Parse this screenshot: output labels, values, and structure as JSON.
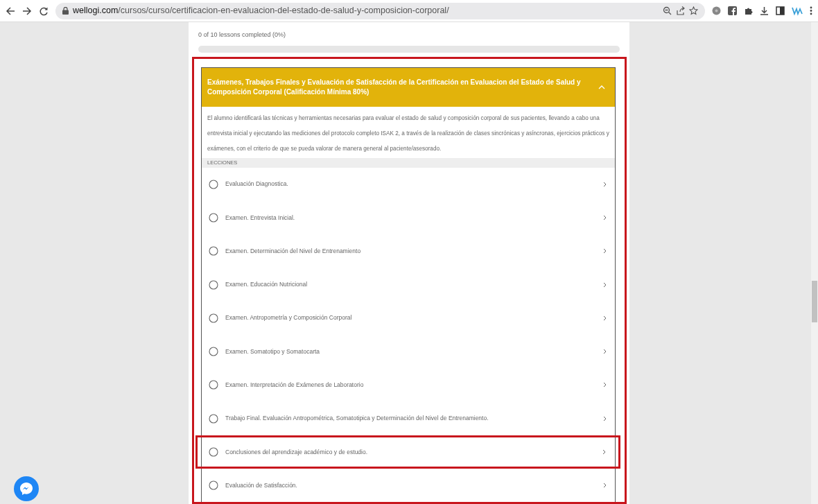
{
  "browser": {
    "url_host": "wellogi.com",
    "url_path": "/cursos/curso/certificacion-en-evaluacion-del-estado-de-salud-y-composicion-corporal/"
  },
  "progress": {
    "text": "0 of 10 lessons completed (0%)",
    "level": 0
  },
  "section": {
    "title": "Exámenes, Trabajos Finales y Evaluación de Satisfacción de la Certificación en Evaluacion del Estado de Salud y Composición Corporal (Calificación Mínima 80%)",
    "expanded": true,
    "highlighted": true,
    "description": "El alumno identificará las técnicas y herramientas necesarias para evaluar el estado de salud y composición corporal de sus pacientes, llevando a cabo una entrevista inicial y ejecutando las mediciones del protocolo completo ISAK 2, a través de la realización de clases sincrónicas y asíncronas, ejercicios prácticos y exámenes, con el criterio de que se pueda valorar de manera general al paciente/asesorado.",
    "lessons_label": "LECCIONES",
    "lessons": [
      {
        "title": "Evaluación Diagnostica.",
        "completed": false,
        "highlighted": false
      },
      {
        "title": "Examen. Entrevista Inicial.",
        "completed": false,
        "highlighted": false
      },
      {
        "title": "Examen. Determinación del Nivel de Entrenamiento",
        "completed": false,
        "highlighted": false
      },
      {
        "title": "Examen. Educación Nutricional",
        "completed": false,
        "highlighted": false
      },
      {
        "title": "Examen. Antropometría y Composición Corporal",
        "completed": false,
        "highlighted": false
      },
      {
        "title": "Examen. Somatotipo y Somatocarta",
        "completed": false,
        "highlighted": false
      },
      {
        "title": "Examen. Interpretación de Exámenes de Laboratorio",
        "completed": false,
        "highlighted": false
      },
      {
        "title": "Trabajo Final. Evaluación Antropométrica, Somatotipica y Determinación del Nivel de Entrenamiento.",
        "completed": false,
        "highlighted": false
      },
      {
        "title": "Conclusiones del aprendizaje académico y de estudio.",
        "completed": false,
        "highlighted": true
      },
      {
        "title": "Evaluación de Satisfacción.",
        "completed": false,
        "highlighted": false
      }
    ]
  }
}
